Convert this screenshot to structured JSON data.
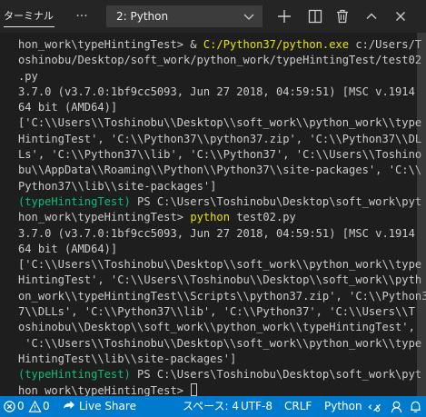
{
  "panel": {
    "tab_label": "ターミナル",
    "more_icon": "ellipsis-icon",
    "terminal_selector": {
      "selected": "2: Python"
    },
    "actions": [
      "plus-icon",
      "split-icon",
      "trash-icon",
      "chevron-up-icon",
      "close-icon"
    ]
  },
  "terminal": {
    "lines": [
      [
        {
          "t": "hon_work\\typeHintingTest> & "
        },
        {
          "t": "C:/Python37/python.exe",
          "c": "yellow"
        },
        {
          "t": " c:/Users/T"
        }
      ],
      [
        {
          "t": "oshinobu/Desktop/soft_work/python_work/typeHintingTest/test02"
        }
      ],
      [
        {
          "t": ".py"
        }
      ],
      [
        {
          "t": "3.7.0 (v3.7.0:1bf9cc5093, Jun 27 2018, 04:59:51) [MSC v.1914"
        }
      ],
      [
        {
          "t": "64 bit (AMD64)]"
        }
      ],
      [
        {
          "t": "['C:\\\\Users\\\\Toshinobu\\\\Desktop\\\\soft_work\\\\python_work\\\\type"
        }
      ],
      [
        {
          "t": "HintingTest', 'C:\\\\Python37\\\\python37.zip', 'C:\\\\Python37\\\\DL"
        }
      ],
      [
        {
          "t": "Ls', 'C:\\\\Python37\\\\lib', 'C:\\\\Python37', 'C:\\\\Users\\\\Toshino"
        }
      ],
      [
        {
          "t": "bu\\\\AppData\\\\Roaming\\\\Python\\\\Python37\\\\site-packages', 'C:\\\\"
        }
      ],
      [
        {
          "t": "Python37\\\\lib\\\\site-packages']"
        }
      ],
      [
        {
          "t": "(typeHintingTest)",
          "c": "green"
        },
        {
          "t": " PS C:\\Users\\Toshinobu\\Desktop\\soft_work\\pyt"
        }
      ],
      [
        {
          "t": "hon_work\\typeHintingTest> "
        },
        {
          "t": "python",
          "c": "yellow"
        },
        {
          "t": " test02.py"
        }
      ],
      [
        {
          "t": "3.7.0 (v3.7.0:1bf9cc5093, Jun 27 2018, 04:59:51) [MSC v.1914"
        }
      ],
      [
        {
          "t": "64 bit (AMD64)]"
        }
      ],
      [
        {
          "t": "['C:\\\\Users\\\\Toshinobu\\\\Desktop\\\\soft_work\\\\python_work\\\\type"
        }
      ],
      [
        {
          "t": "HintingTest', 'C:\\\\Users\\\\Toshinobu\\\\Desktop\\\\soft_work\\\\pyth"
        }
      ],
      [
        {
          "t": "on_work\\\\typeHintingTest\\\\Scripts\\\\python37.zip', 'C:\\\\Python3"
        }
      ],
      [
        {
          "t": "7\\\\DLLs', 'C:\\\\Python37\\\\lib', 'C:\\\\Python37', 'C:\\\\Users\\\\T"
        }
      ],
      [
        {
          "t": "oshinobu\\\\Desktop\\\\soft_work\\\\python_work\\\\typeHintingTest',"
        }
      ],
      [
        {
          "t": " 'C:\\\\Users\\\\Toshinobu\\\\Desktop\\\\soft_work\\\\python_work\\\\type"
        }
      ],
      [
        {
          "t": "HintingTest\\\\lib\\\\site-packages']"
        }
      ],
      [
        {
          "t": "(typeHintingTest)",
          "c": "green"
        },
        {
          "t": " PS C:\\Users\\Toshinobu\\Desktop\\soft_work\\pyt"
        }
      ],
      [
        {
          "t": "hon_work\\typeHintingTest> "
        },
        {
          "cursor": true
        }
      ]
    ]
  },
  "statusbar": {
    "errors": "0",
    "warnings": "0",
    "live_share": "Live Share",
    "spaces": "スペース: 4",
    "encoding": "UTF-8",
    "eol": "CRLF",
    "language": "Python",
    "icons": [
      "error-icon",
      "warning-icon",
      "live-share-icon",
      "remote-icon",
      "feedback-icon",
      "bell-icon"
    ]
  },
  "colors": {
    "terminal_bg": "#1e1e1e",
    "header_bg": "#252526",
    "text": "#cccccc",
    "yellow": "#e5e510",
    "green": "#0dbc79",
    "statusbar": "#007acc"
  }
}
